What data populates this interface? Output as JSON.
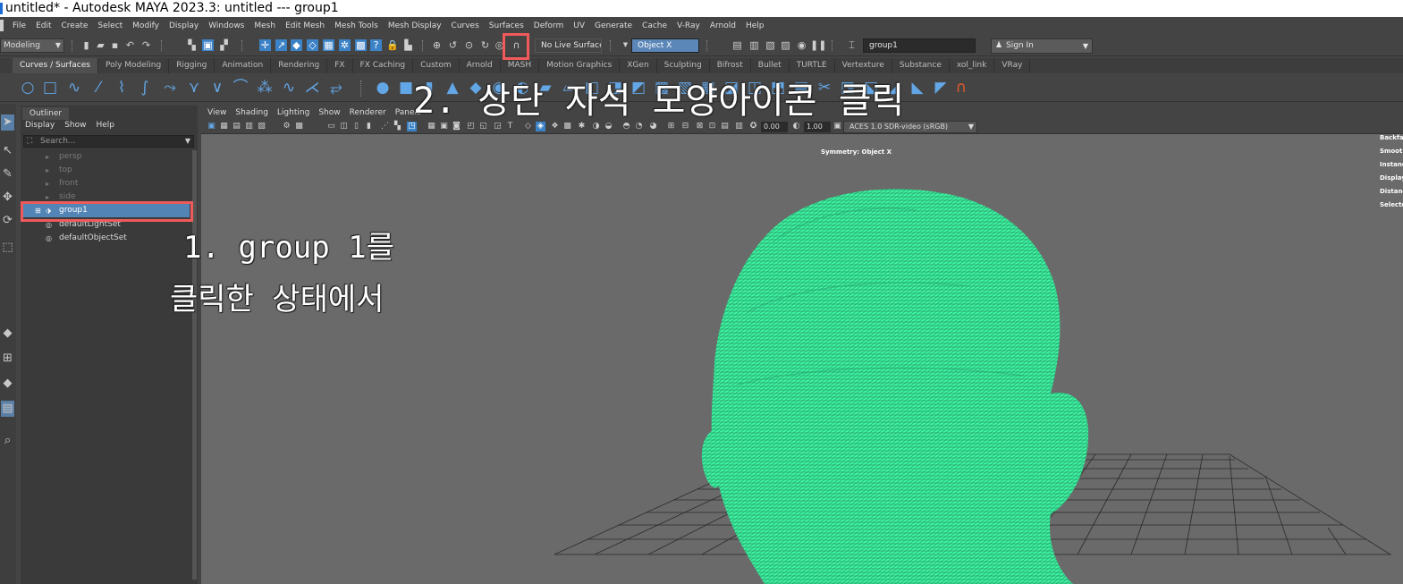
{
  "window": {
    "title": "untitled* - Autodesk MAYA 2023.3: untitled    ---    group1"
  },
  "menubar": {
    "items": [
      "File",
      "Edit",
      "Create",
      "Select",
      "Modify",
      "Display",
      "Windows",
      "Mesh",
      "Edit Mesh",
      "Mesh Tools",
      "Mesh Display",
      "Curves",
      "Surfaces",
      "Deform",
      "UV",
      "Generate",
      "Cache",
      "V-Ray",
      "Arnold",
      "Help"
    ]
  },
  "statusline": {
    "menuset": "Modeling",
    "live_surface": "No Live Surface",
    "symmetry": "Object X",
    "selection_field": "group1",
    "sign_in": "Sign In"
  },
  "shelf": {
    "tabs": [
      "Curves / Surfaces",
      "Poly Modeling",
      "Rigging",
      "Animation",
      "Rendering",
      "FX",
      "FX Caching",
      "Custom",
      "Arnold",
      "MASH",
      "Motion Graphics",
      "XGen",
      "Sculpting",
      "Bifrost",
      "Bullet",
      "TURTLE",
      "Vertexture",
      "Substance",
      "xol_link",
      "VRay"
    ],
    "active_tab": "Curves / Surfaces"
  },
  "outliner": {
    "tab": "Outliner",
    "menu": [
      "Display",
      "Show",
      "Help"
    ],
    "search_placeholder": "Search...",
    "items": [
      {
        "label": "persp",
        "icon": "camera-icon",
        "state": "dim"
      },
      {
        "label": "top",
        "icon": "camera-icon",
        "state": "dim"
      },
      {
        "label": "front",
        "icon": "camera-icon",
        "state": "dim"
      },
      {
        "label": "side",
        "icon": "camera-icon",
        "state": "dim"
      },
      {
        "label": "group1",
        "icon": "group-icon",
        "state": "selected"
      },
      {
        "label": "defaultLightSet",
        "icon": "set-icon",
        "state": "normal"
      },
      {
        "label": "defaultObjectSet",
        "icon": "set-icon",
        "state": "normal"
      }
    ]
  },
  "viewport": {
    "menu": [
      "View",
      "Shading",
      "Lighting",
      "Show",
      "Renderer",
      "Panels"
    ],
    "field_a": "0.00",
    "field_b": "1.00",
    "color_space": "ACES 1.0 SDR-video (sRGB)",
    "hud_center": "Symmetry: Object X",
    "hud_right": [
      "Backfa",
      "Smoot",
      "Instanc",
      "Display",
      "Distanc",
      "Selecte"
    ]
  },
  "annotations": {
    "step1_line1": "1. group 1를",
    "step1_line2": "클릭한 상태에서",
    "step2": "2. 상단 자석 모양아이콘 클릭"
  },
  "colors": {
    "highlight": "#f05a5a",
    "selection": "#5285b6",
    "mesh": "#3df2a0",
    "grid": "#2a2a2a"
  }
}
